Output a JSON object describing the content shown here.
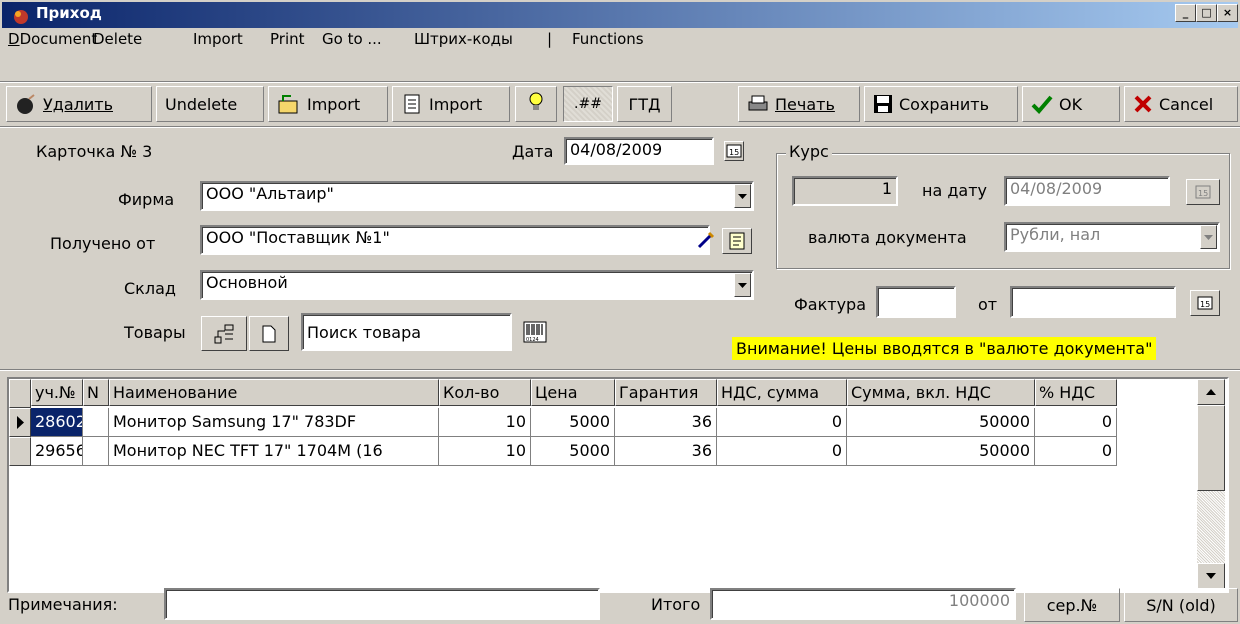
{
  "window": {
    "title": "Приход"
  },
  "menu": [
    "Document",
    "Delete",
    "Import",
    "Print",
    "Go to ...",
    "Штрих-коды",
    "|",
    "Functions"
  ],
  "toolbar": {
    "delete": "Удалить",
    "undelete": "Undelete",
    "import1": "Import",
    "import2": "Import",
    "hash": ".##",
    "gtd": "ГТД",
    "print": "Печать",
    "save": "Сохранить",
    "ok": "OK",
    "cancel": "Cancel"
  },
  "form": {
    "card": "Карточка № 3",
    "date_label": "Дата",
    "date_value": "04/08/2009",
    "firm_label": "Фирма",
    "firm_value": "ООО \"Альтаир\"",
    "received_label": "Получено от",
    "received_value": "ООО \"Поставщик №1\"",
    "warehouse_label": "Склад",
    "warehouse_value": "Основной",
    "goods_label": "Товары",
    "search_value": "Поиск товара"
  },
  "rate": {
    "group_label": "Курс",
    "rate_value": "1",
    "on_date_label": "на дату",
    "on_date_value": "04/08/2009",
    "currency_label": "валюта документа",
    "currency_value": "Рубли, нал"
  },
  "invoice": {
    "label": "Фактура",
    "from_label": "от",
    "number": "",
    "date": ""
  },
  "warning": "Внимание! Цены вводятся в \"валюте документа\"",
  "table": {
    "columns": [
      "уч.№",
      "N",
      "Наименование",
      "Кол-во",
      "Цена",
      "Гарантия",
      "НДС, сумма",
      "Сумма, вкл. НДС",
      "% НДС"
    ],
    "rows": [
      [
        "28602",
        "",
        "Монитор Samsung 17\" 783DF",
        "10",
        "5000",
        "36",
        "0",
        "50000",
        "0"
      ],
      [
        "29656",
        "",
        "Монитор NEC TFT 17\" 1704M (16",
        "10",
        "5000",
        "36",
        "0",
        "50000",
        "0"
      ]
    ]
  },
  "footer": {
    "notes_label": "Примечания:",
    "notes_value": "",
    "total_label": "Итого",
    "total_value": "100000",
    "serial_btn": "сер.№",
    "sn_old_btn": "S/N (old)"
  },
  "colors": {
    "face": "#d4d0c8",
    "titlebar": "#0a246a",
    "warning_bg": "#ffff00",
    "selected": "#0a246a"
  }
}
